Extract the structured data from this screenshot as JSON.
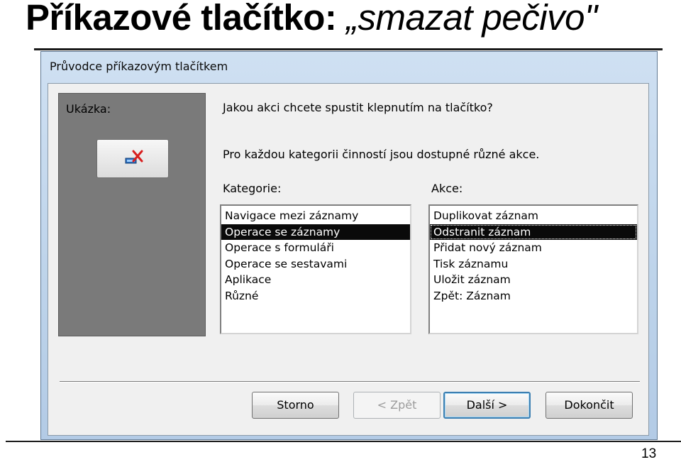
{
  "slide": {
    "title_prefix": "Příkazové tlačítko: ",
    "title_quoted": "„smazat pečivo\"",
    "page_number": "13"
  },
  "dialog": {
    "title": "Průvodce příkazovým tlačítkem",
    "preview_label": "Ukázka:",
    "preview_icon": "delete-record-icon",
    "question": "Jakou akci chcete spustit klepnutím na tlačítko?",
    "info": "Pro každou kategorii činností jsou dostupné různé akce.",
    "categories_label": "Kategorie:",
    "actions_label": "Akce:",
    "categories": [
      "Navigace mezi záznamy",
      "Operace se záznamy",
      "Operace s formuláři",
      "Operace se sestavami",
      "Aplikace",
      "Různé"
    ],
    "selected_category": "Operace se záznamy",
    "actions": [
      "Duplikovat záznam",
      "Odstranit záznam",
      "Přidat nový záznam",
      "Tisk záznamu",
      "Uložit záznam",
      "Zpět: Záznam"
    ],
    "selected_action": "Odstranit záznam",
    "buttons": {
      "cancel": "Storno",
      "back": "< Zpět",
      "next": "Další >",
      "finish": "Dokončit"
    }
  },
  "colors": {
    "selection": "#0a0a0a",
    "preview_panel": "#7a7a7a",
    "frame": "#bdd3ea",
    "default_button_border": "#3c7fb1"
  }
}
